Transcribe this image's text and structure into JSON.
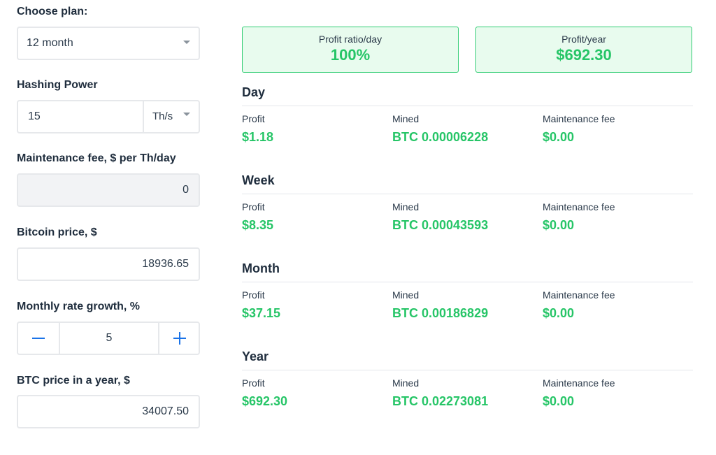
{
  "calculator": {
    "plan": {
      "label": "Choose plan:",
      "value": "12 month"
    },
    "hashing": {
      "label": "Hashing Power",
      "value": "15",
      "unit": "Th/s"
    },
    "maintenance": {
      "label": "Maintenance fee, $ per Th/day",
      "value": "0"
    },
    "bitcoin_price": {
      "label": "Bitcoin price, $",
      "value": "18936.65"
    },
    "growth": {
      "label": "Monthly rate growth, %",
      "value": "5"
    },
    "btc_year": {
      "label": "BTC price in a year, $",
      "value": "34007.50"
    }
  },
  "summary": {
    "ratio": {
      "label": "Profit ratio/day",
      "value": "100%"
    },
    "year": {
      "label": "Profit/year",
      "value": "$692.30"
    }
  },
  "column_labels": {
    "profit": "Profit",
    "mined": "Mined",
    "fee": "Maintenance fee"
  },
  "periods": [
    {
      "title": "Day",
      "profit": "$1.18",
      "mined": "BTC 0.00006228",
      "fee": "$0.00"
    },
    {
      "title": "Week",
      "profit": "$8.35",
      "mined": "BTC 0.00043593",
      "fee": "$0.00"
    },
    {
      "title": "Month",
      "profit": "$37.15",
      "mined": "BTC 0.00186829",
      "fee": "$0.00"
    },
    {
      "title": "Year",
      "profit": "$692.30",
      "mined": "BTC 0.02273081",
      "fee": "$0.00"
    }
  ],
  "colors": {
    "accent_green": "#26c567",
    "card_bg": "#e8fbee",
    "stepper_blue": "#1a73e8"
  }
}
